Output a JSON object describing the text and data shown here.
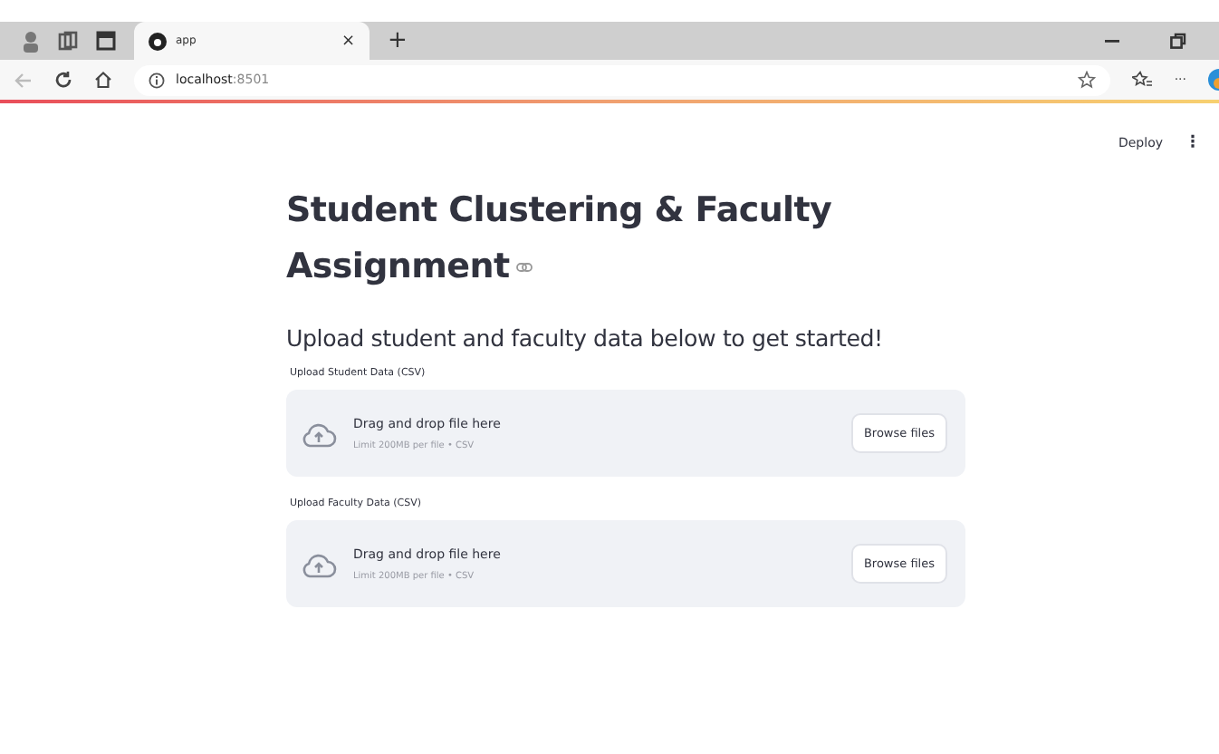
{
  "browser": {
    "tab_title": "app",
    "close": "×",
    "new_tab": "+",
    "url_host": "localhost",
    "url_port": ":8501",
    "more": "···"
  },
  "toolbar": {
    "deploy": "Deploy",
    "menu": "⋮"
  },
  "title_lines": [
    "Student Clustering & Faculty",
    "Assignment"
  ],
  "subtitle": "Upload student and faculty data below to get started!",
  "uploaders": [
    {
      "label": "Upload Student Data (CSV)",
      "instruction": "Drag and drop file here",
      "limit": "Limit 200MB per file • CSV",
      "button": "Browse files"
    },
    {
      "label": "Upload Faculty Data (CSV)",
      "instruction": "Drag and drop file here",
      "limit": "Limit 200MB per file • CSV",
      "button": "Browse files"
    }
  ]
}
